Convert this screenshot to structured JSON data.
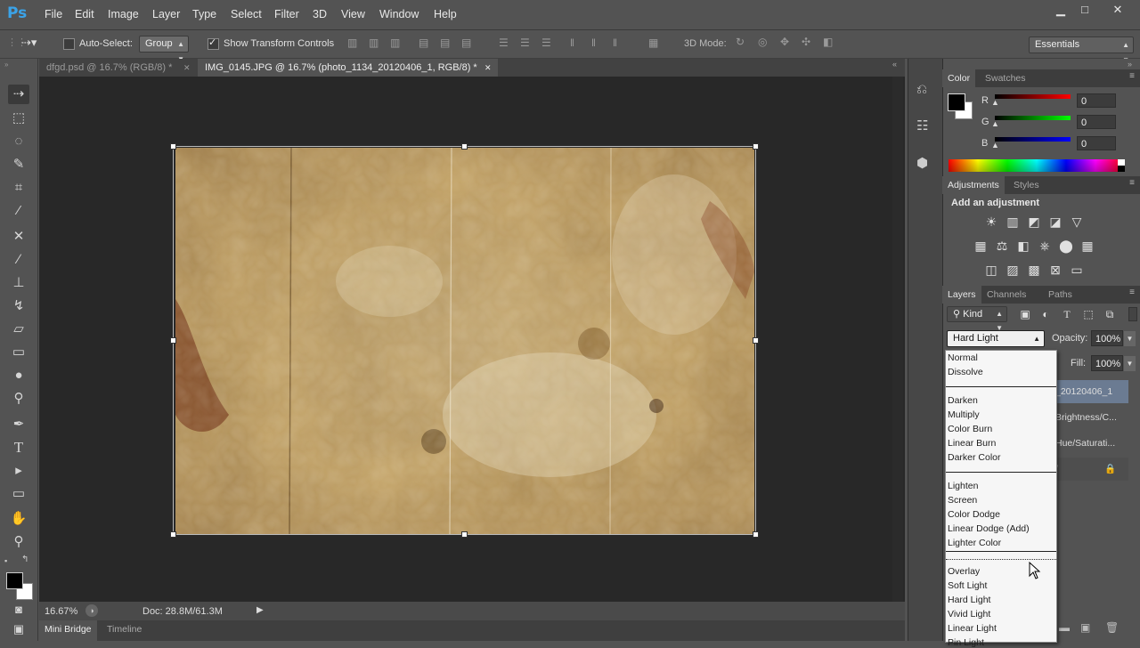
{
  "app": {
    "logo": "Ps"
  },
  "menu": [
    "File",
    "Edit",
    "Image",
    "Layer",
    "Type",
    "Select",
    "Filter",
    "3D",
    "View",
    "Window",
    "Help"
  ],
  "window_controls": {
    "minimize": "▁",
    "maximize": "□",
    "close": "✕"
  },
  "options": {
    "auto_select_label": "Auto-Select:",
    "auto_select_value": "Group",
    "show_transform_label": "Show Transform Controls",
    "mode_3d_label": "3D Mode:",
    "workspace": "Essentials"
  },
  "tabs": [
    {
      "label": "dfgd.psd @ 16.7% (RGB/8) *",
      "close": "✕"
    },
    {
      "label": "IMG_0145.JPG @ 16.7% (photo_1134_20120406_1, RGB/8) *",
      "close": "✕"
    }
  ],
  "status": {
    "zoom": "16.67%",
    "doc": "Doc: 28.8M/61.3M"
  },
  "bottom_tabs": [
    "Mini Bridge",
    "Timeline"
  ],
  "color_panel": {
    "tabs": [
      "Color",
      "Swatches"
    ],
    "r_label": "R",
    "g_label": "G",
    "b_label": "B",
    "r": "0",
    "g": "0",
    "b": "0"
  },
  "adjustments_panel": {
    "tabs": [
      "Adjustments",
      "Styles"
    ],
    "heading": "Add an adjustment"
  },
  "layers_panel": {
    "tabs": [
      "Layers",
      "Channels",
      "Paths"
    ],
    "kind": "Kind",
    "blend_mode": "Hard Light",
    "opacity_label": "Opacity:",
    "opacity": "100%",
    "fill_label": "Fill:",
    "fill": "100%",
    "layers": [
      "_20120406_1",
      "Brightness/C...",
      "Hue/Saturati..."
    ]
  },
  "blend_modes": {
    "group1": [
      "Normal",
      "Dissolve"
    ],
    "group2": [
      "Darken",
      "Multiply",
      "Color Burn",
      "Linear Burn",
      "Darker Color"
    ],
    "group3": [
      "Lighten",
      "Screen",
      "Color Dodge",
      "Linear Dodge (Add)",
      "Lighter Color"
    ],
    "group4": [
      "Overlay",
      "Soft Light",
      "Hard Light",
      "Vivid Light",
      "Linear Light",
      "Pin Light"
    ]
  },
  "colors": {
    "accent_logo": "#3ba3e8",
    "canvas_bg": "#282828",
    "ui_bg": "#535353"
  }
}
